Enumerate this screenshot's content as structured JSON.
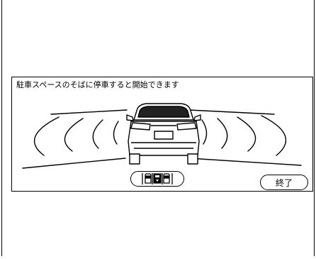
{
  "screen": {
    "message": "駐車スペースのそばに停車すると開始できます",
    "end_button_label": "終了"
  },
  "icons": {
    "scene": "parking-guide-illustration",
    "sensor_button": "parking-sensor-icon"
  },
  "colors": {
    "line": "#000000",
    "background": "#ffffff"
  }
}
